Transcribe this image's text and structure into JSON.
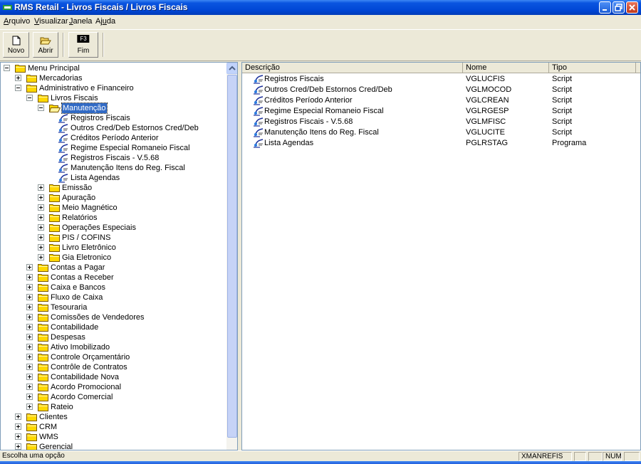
{
  "window": {
    "title": "RMS Retail - Livros Fiscais / Livros Fiscais"
  },
  "menu": [
    {
      "pre": "",
      "key": "A",
      "post": "rquivo"
    },
    {
      "pre": "",
      "key": "V",
      "post": "isualizar"
    },
    {
      "pre": "",
      "key": "J",
      "post": "anela"
    },
    {
      "pre": "Aj",
      "key": "u",
      "post": "da"
    }
  ],
  "toolbar": {
    "novo": "Novo",
    "abrir": "Abrir",
    "fim_key": "F3",
    "fim": "Fim"
  },
  "tree": {
    "root": "Menu Principal",
    "mercadorias": "Mercadorias",
    "admin": "Administrativo e Financeiro",
    "livros": "Livros Fiscais",
    "manutencao": "Manutenção",
    "leaves": [
      "Registros Fiscais",
      "Outros Cred/Deb Estornos Cred/Deb",
      "Créditos Período Anterior",
      "Regime Especial Romaneio Fiscal",
      "Registros Fiscais - V.5.68",
      "Manutenção Itens do Reg. Fiscal",
      "Lista Agendas"
    ],
    "livros_children": [
      "Emissão",
      "Apuração",
      "Meio Magnético",
      "Relatórios",
      "Operações Especiais",
      "PIS / COFINS",
      "Livro Eletrônico",
      "Gia Eletronico"
    ],
    "admin_children": [
      "Contas a Pagar",
      "Contas a Receber",
      "Caixa e Bancos",
      "Fluxo de Caixa",
      "Tesouraria",
      "Comissões de Vendedores",
      "Contabilidade",
      "Despesas",
      "Ativo Imobilizado",
      "Controle Orçamentário",
      "Contrôle de Contratos",
      "Contabilidade Nova",
      "Acordo Promocional",
      "Acordo Comercial",
      "Rateio"
    ],
    "root_children": [
      "Clientes",
      "CRM",
      "WMS",
      "Gerencial"
    ]
  },
  "list": {
    "headers": {
      "descricao": "Descrição",
      "nome": "Nome",
      "tipo": "Tipo"
    },
    "rows": [
      {
        "desc": "Registros Fiscais",
        "nome": "VGLUCFIS",
        "tipo": "Script"
      },
      {
        "desc": "Outros Cred/Deb Estornos Cred/Deb",
        "nome": "VGLMOCOD",
        "tipo": "Script"
      },
      {
        "desc": "Créditos Período Anterior",
        "nome": "VGLCREAN",
        "tipo": "Script"
      },
      {
        "desc": "Regime Especial Romaneio Fiscal",
        "nome": "VGLRGESP",
        "tipo": "Script"
      },
      {
        "desc": "Registros Fiscais - V.5.68",
        "nome": "VGLMFISC",
        "tipo": "Script"
      },
      {
        "desc": "Manutenção Itens do Reg. Fiscal",
        "nome": "VGLUCITE",
        "tipo": "Script"
      },
      {
        "desc": "Lista Agendas",
        "nome": "PGLRSTAG",
        "tipo": "Programa"
      }
    ]
  },
  "status": {
    "message": "Escolha uma opção",
    "user": "XMANREFIS",
    "num": "NUM"
  },
  "colors": {
    "selection": "#316ac5",
    "titlebar": "#0a55e0",
    "folder": "#ffd800"
  }
}
